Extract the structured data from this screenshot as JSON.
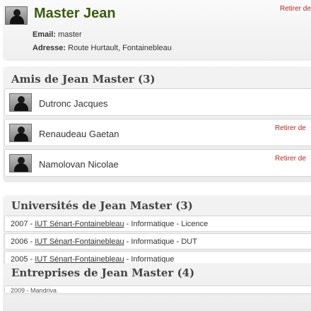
{
  "profile": {
    "name": "Master Jean",
    "remove_label": "Retirer de",
    "email_label": "Email:",
    "email_value": "master",
    "address_label": "Adresse:",
    "address_value": "Route Hurtault, Fontainebleau"
  },
  "friends": {
    "title": "Amis de Jean Master (3)",
    "items": [
      {
        "name": "Dutronc Jacques",
        "remove_label": ""
      },
      {
        "name": "Renaudeau Gaetan",
        "remove_label": "Retirer de"
      },
      {
        "name": "Namolovan Nicolae",
        "remove_label": "Retirer de"
      }
    ]
  },
  "universities": {
    "title": "Universités de Jean Master (3)",
    "items": [
      {
        "year": "2007 - ",
        "school": "IUT Sénart-Fontainebleau",
        "detail": " - Informatique - Licence"
      },
      {
        "year": "2006 - ",
        "school": "IUT Sénart-Fontainebleau",
        "detail": " - Informatique - DUT"
      },
      {
        "year": "2005 - ",
        "school": "IUT Sénart-Fontainebleau",
        "detail": " - Informatique"
      }
    ]
  },
  "companies": {
    "title": "Entreprises de Jean Master (4)",
    "first_item": "2009 - Mandriva"
  },
  "colors": {
    "name_green": "#3c5a14",
    "remove_red": "#b02a2a"
  },
  "icons": {
    "avatar": "user-avatar-icon"
  }
}
